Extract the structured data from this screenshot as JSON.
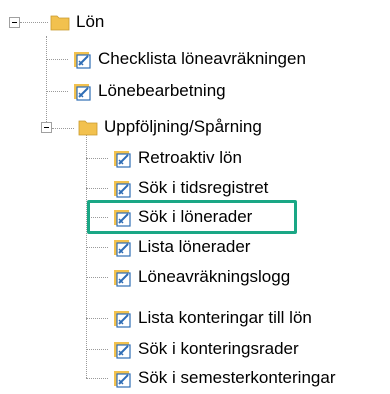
{
  "tree": {
    "root": {
      "label": "Lön",
      "icon": "folder-icon",
      "expanded": true
    },
    "items": [
      {
        "label": "Checklista löneavräkningen",
        "icon": "report-icon"
      },
      {
        "label": "Lönebearbetning",
        "icon": "report-icon"
      },
      {
        "label": "Uppföljning/Spårning",
        "icon": "folder-icon",
        "expanded": true,
        "children": [
          {
            "label": "Retroaktiv lön",
            "icon": "report-icon"
          },
          {
            "label": "Sök i tidsregistret",
            "icon": "report-icon"
          },
          {
            "label": "Sök i lönerader",
            "icon": "report-icon",
            "highlighted": true
          },
          {
            "label": "Lista lönerader",
            "icon": "report-icon"
          },
          {
            "label": "Löneavräkningslogg",
            "icon": "report-icon"
          },
          {
            "label": "Lista konteringar till lön",
            "icon": "report-icon"
          },
          {
            "label": "Sök i konteringsrader",
            "icon": "report-icon"
          },
          {
            "label": "Sök i semesterkonteringar",
            "icon": "report-icon"
          }
        ]
      }
    ]
  },
  "colors": {
    "highlight": "#1aa785",
    "folder": "#f2c14e",
    "report_blue": "#2f6db5"
  }
}
